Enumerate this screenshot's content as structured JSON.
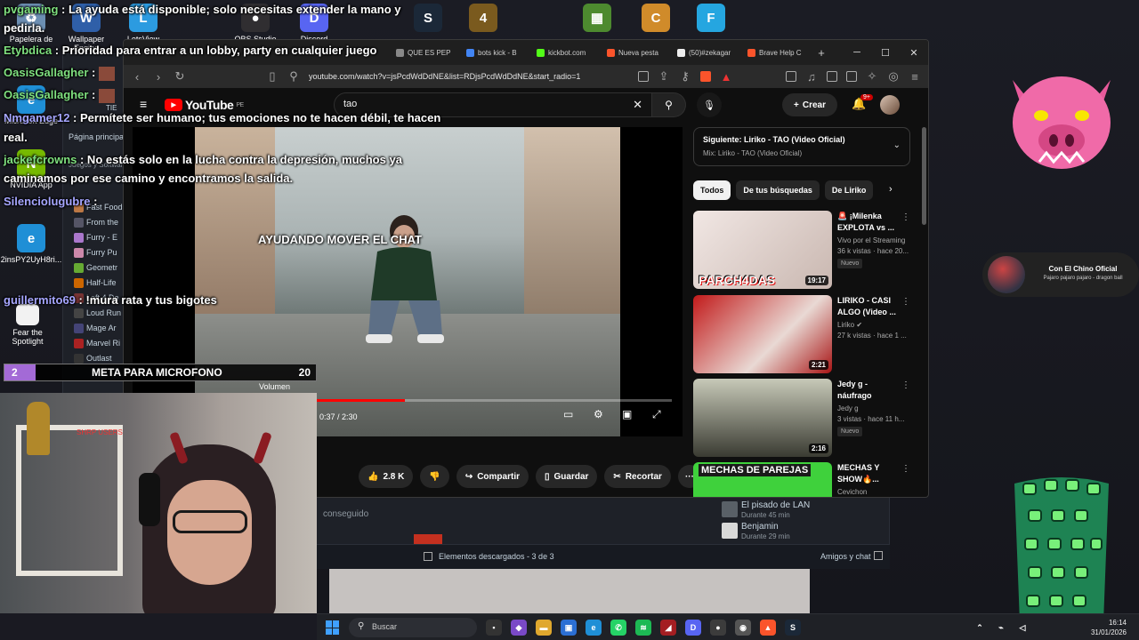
{
  "desktop": {
    "icons": [
      {
        "label": "Papelera de",
        "name": "recycle-bin-icon",
        "color": "#6c8fb3",
        "glyph": "♻"
      },
      {
        "label": "Wallpaper Engine",
        "name": "wallpaper-engine-icon",
        "color": "#2f5fa8",
        "glyph": "W"
      },
      {
        "label": "LetsView",
        "name": "letsview-icon",
        "color": "#2c9be0",
        "glyph": "L"
      },
      {
        "label": "OBS Studio",
        "name": "obs-icon",
        "color": "#302e31",
        "glyph": "●"
      },
      {
        "label": "Discord",
        "name": "discord-icon",
        "color": "#5865f2",
        "glyph": "D"
      },
      {
        "label": "Steam",
        "name": "steam-icon",
        "color": "#1b2838",
        "glyph": "S"
      },
      {
        "label": "Left 4 Dead 2",
        "name": "l4d2-icon",
        "color": "#7a5a1e",
        "glyph": "4"
      },
      {
        "label": "TLauncher",
        "name": "tlauncher-icon",
        "color": "#4d8a2f",
        "glyph": "▦"
      },
      {
        "label": "Counter-Strike 2",
        "name": "cs2-icon",
        "color": "#d08b2a",
        "glyph": "C"
      },
      {
        "label": "Fortnite",
        "name": "fortnite-icon",
        "color": "#25a6e0",
        "glyph": "F"
      },
      {
        "label": "Microsoft Edge",
        "name": "edge-icon",
        "color": "#1f8fd6",
        "glyph": "e"
      },
      {
        "label": "NVIDIA App",
        "name": "nvidia-icon",
        "color": "#76b900",
        "glyph": "N"
      },
      {
        "label": "2insPY2UyH8ri...",
        "name": "edge-shortcut-icon",
        "color": "#1f8fd6",
        "glyph": "e"
      },
      {
        "label": "Fear the Spotlight",
        "name": "fear-spotlight-icon",
        "color": "#f2f2f2",
        "glyph": ""
      }
    ]
  },
  "chat": [
    {
      "user": "pvgaming",
      "text": " : La ayuda está disponible; solo necesitas extender la mano y"
    },
    {
      "user": "",
      "text": "pedirla."
    },
    {
      "user": "Etybdica",
      "text": " : Prioridad para entrar a un lobby, party en cualquier juego"
    },
    {
      "user": "OasisGallagher",
      "text": " :"
    },
    {
      "user": "OasisGallagher",
      "text": " :"
    },
    {
      "user": "Nmgamer12",
      "text": " : Permítete ser humano; tus emociones no te hacen débil, te hacen"
    },
    {
      "user": "",
      "text": "real."
    },
    {
      "user": "jackefcrowns",
      "text": " : No estás solo en la lucha contra la depresión, muchos ya"
    },
    {
      "user": "",
      "text": "caminamos por ese camino y encontramos la salida."
    },
    {
      "user": "Silenciolugubre",
      "text": " :"
    },
    {
      "user": "guillermito69",
      "text": " : !mura rata y tus bigotes"
    }
  ],
  "overlay": {
    "video_caption": "AYUDANDO MOVER EL CHAT",
    "goal": {
      "count": "2",
      "label": "META PARA MICROFONO",
      "target": "20",
      "progress": 0.1
    },
    "volume_label": "Volumen",
    "webcam_text": "SHRP USERS",
    "alert": {
      "name": "Con El Chino Oficial",
      "subtitle": "Pajaro pajaro pajaro - dragon ball"
    }
  },
  "steam": {
    "sidebar_header": "Página principal",
    "sidebar_sub": "Juegos y Software",
    "games": [
      {
        "name": "Fast Food",
        "color": "#b74"
      },
      {
        "name": "From the",
        "color": "#556"
      },
      {
        "name": "Furry - E",
        "color": "#a7c"
      },
      {
        "name": "Furry Pu",
        "color": "#c8a"
      },
      {
        "name": "Geometr",
        "color": "#6a3"
      },
      {
        "name": "Half-Life",
        "color": "#c60"
      },
      {
        "name": "Left 4 De",
        "color": "#733"
      },
      {
        "name": "Loud Run",
        "color": "#444"
      },
      {
        "name": "Mage Ar",
        "color": "#447"
      },
      {
        "name": "Marvel Ri",
        "color": "#a22"
      },
      {
        "name": "Outlast",
        "color": "#333"
      }
    ],
    "achievement_text": "conseguido",
    "downloads": "Elementos descargados - 3 de 3",
    "friends_chat": "Amigos y chat",
    "friends": [
      {
        "name": "El pisado de LAN",
        "status": "Durante 45 min"
      },
      {
        "name": "Benjamin",
        "status": "Durante 29 min"
      }
    ],
    "tag": "TIE"
  },
  "browser": {
    "tabs": [
      {
        "label": "QUE ES PEP",
        "color": "#888"
      },
      {
        "label": "bots kick - B",
        "color": "#4285f4"
      },
      {
        "label": "kickbot.com",
        "color": "#53fc18"
      },
      {
        "label": "Nueva pesta",
        "color": "#fb542b"
      },
      {
        "label": "(50)#zekagar",
        "color": "#111"
      },
      {
        "label": "Brave Help C",
        "color": "#fb542b"
      }
    ],
    "url": "youtube.com/watch?v=jsPcdWdDdNE&list=RDjsPcdWdDdNE&start_radio=1"
  },
  "youtube": {
    "logo": "YouTube",
    "region": "PE",
    "search_value": "tao",
    "create_label": "Crear",
    "notif_badge": "9+",
    "time": "0:37 / 2:30",
    "progress": 0.25,
    "likes": "2.8 K",
    "share": "Compartir",
    "save": "Guardar",
    "clip": "Recortar",
    "up_next_title": "Siguiente: Liriko - TAO (Video Oficial)",
    "up_next_mix": "Mix: Liriko - TAO (Video Oficial)",
    "chips": [
      "Todos",
      "De tus búsquedas",
      "De Liriko"
    ],
    "recommendations": [
      {
        "title": "🚨 ¡Milenka EXPLOTA vs ...",
        "channel": "Vivo por el Streaming",
        "meta": "36 k vistas · hace 20...",
        "badge": "Nuevo",
        "duration": "19:17",
        "thumb_text": "PARCH4DAS"
      },
      {
        "title": "LIRIKO - CASI ALGO (Video ...",
        "channel": "Liriko ✔",
        "meta": "27 k vistas · hace 1 ...",
        "badge": "",
        "duration": "2:21",
        "thumb_text": ""
      },
      {
        "title": "Jedy g - náufrago",
        "channel": "Jedy g",
        "meta": "3 vistas · hace 11 h...",
        "badge": "Nuevo",
        "duration": "2:16",
        "thumb_text": ""
      },
      {
        "title": "MECHAS Y SHOW🔥...",
        "channel": "Cevichon",
        "meta": "",
        "badge": "",
        "duration": "",
        "thumb_text": "MECHAS DE PAREJAS"
      }
    ]
  },
  "taskbar": {
    "search_placeholder": "Buscar",
    "time": "16:14",
    "date": "31/01/2026"
  }
}
